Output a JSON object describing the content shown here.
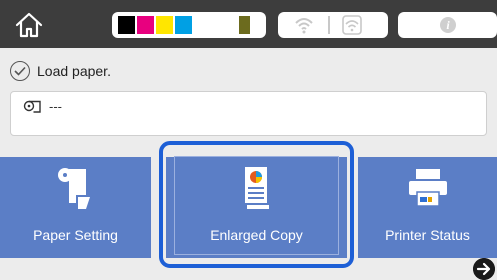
{
  "header": {
    "home_icon": "home-icon",
    "ink_colors": [
      "#000000",
      "#e8007f",
      "#ffe600",
      "#00a0e4",
      "#6c6b1e"
    ],
    "wifi_icon": "wifi-icon",
    "wifi_direct_icon": "wifi-direct-icon",
    "info_symbol": "i"
  },
  "status": {
    "icon": "checkmark-circle-icon",
    "message": "Load paper."
  },
  "paper": {
    "icon": "roll-paper-icon",
    "value": "---"
  },
  "tiles": [
    {
      "label": "Paper Setting",
      "icon": "paper-setting-icon"
    },
    {
      "label": "Enlarged Copy",
      "icon": "enlarged-copy-icon"
    },
    {
      "label": "Printer Status",
      "icon": "printer-status-icon"
    }
  ],
  "colors": {
    "tile": "#5b7ec6",
    "selection": "#1d5fd6",
    "topbar": "#3d3d3d"
  },
  "scroll_icon": "arrow-right-icon"
}
